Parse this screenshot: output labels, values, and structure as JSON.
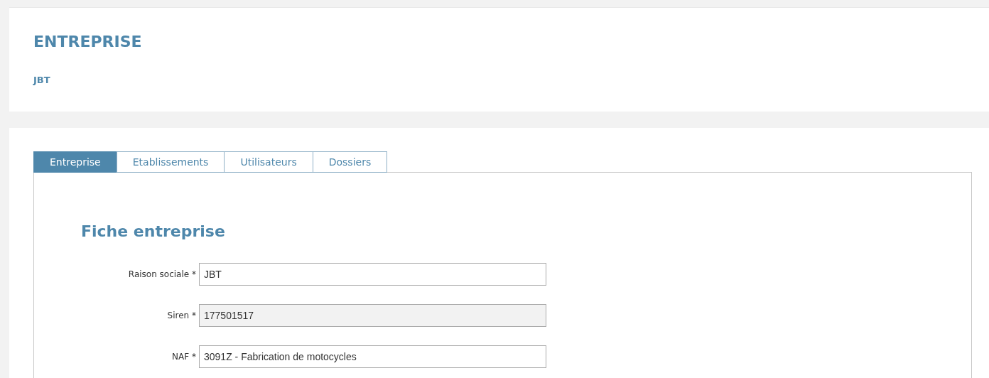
{
  "header": {
    "title": "ENTREPRISE",
    "subtitle": "JBT"
  },
  "tabs": [
    {
      "label": "Entreprise",
      "selected": true
    },
    {
      "label": "Etablissements",
      "selected": false
    },
    {
      "label": "Utilisateurs",
      "selected": false
    },
    {
      "label": "Dossiers",
      "selected": false
    }
  ],
  "form": {
    "title": "Fiche entreprise",
    "fields": [
      {
        "label": "Raison sociale *",
        "value": "JBT",
        "disabled": false
      },
      {
        "label": "Siren *",
        "value": "177501517",
        "disabled": true
      },
      {
        "label": "NAF *",
        "value": "3091Z - Fabrication de motocycles",
        "disabled": false
      }
    ]
  }
}
